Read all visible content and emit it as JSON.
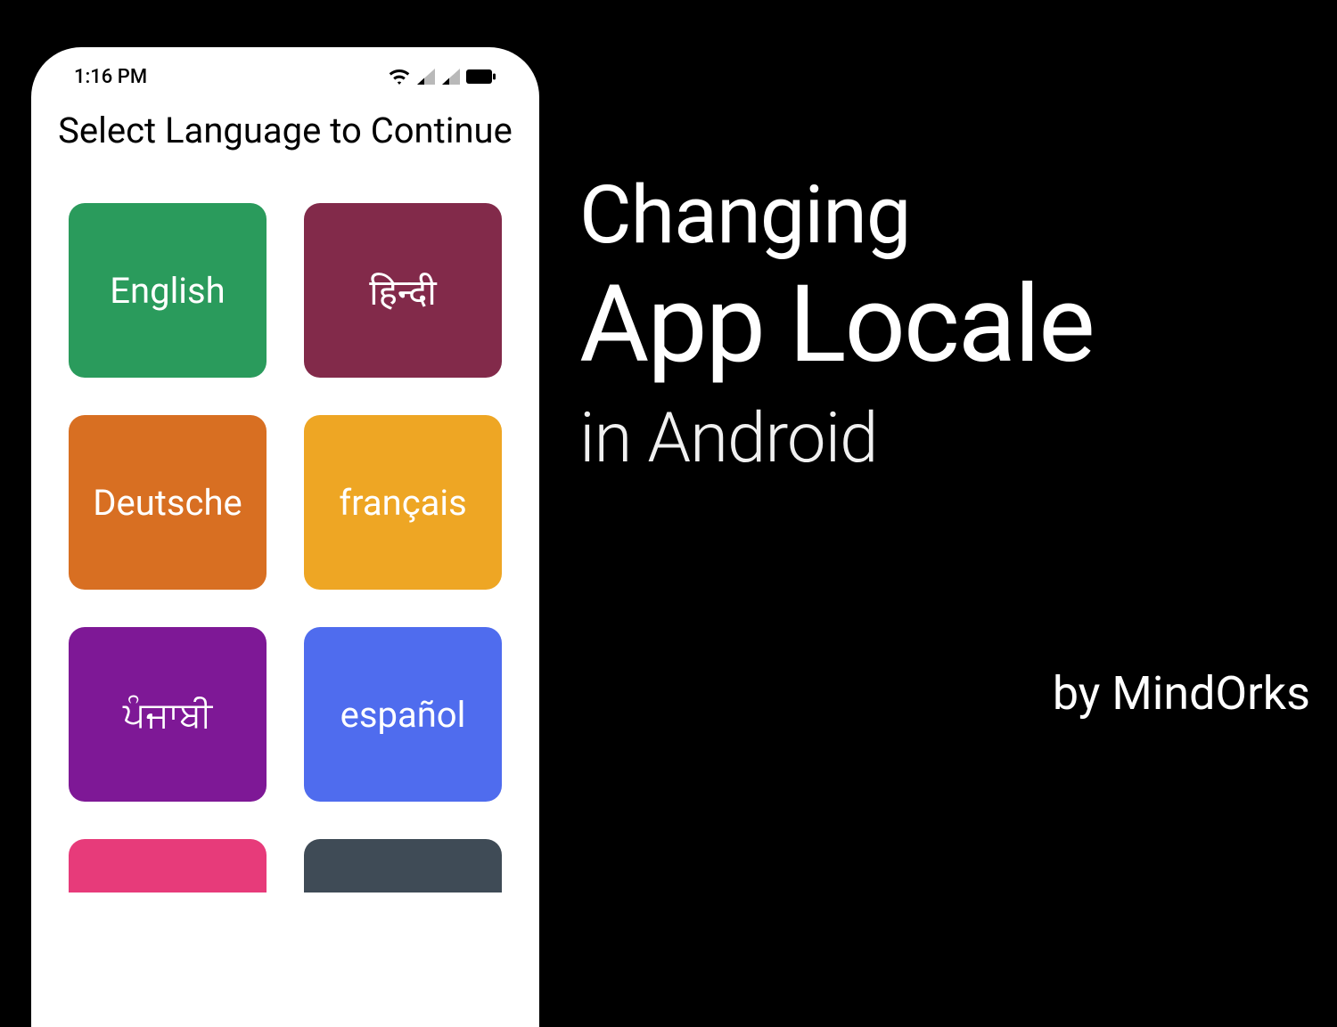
{
  "status": {
    "time": "1:16 PM"
  },
  "screen": {
    "title": "Select Language to Continue"
  },
  "languages": [
    {
      "label": "English",
      "color": "#2a9b5c"
    },
    {
      "label": "हिन्दी",
      "color": "#822a4a"
    },
    {
      "label": "Deutsche",
      "color": "#d86f22"
    },
    {
      "label": "français",
      "color": "#eea624"
    },
    {
      "label": "ਪੰਜਾਬੀ",
      "color": "#7e1896"
    },
    {
      "label": "español",
      "color": "#4f6cee"
    },
    {
      "label": "",
      "color": "#e73b7a"
    },
    {
      "label": "",
      "color": "#3f4b56"
    }
  ],
  "headline": {
    "line1": "Changing",
    "line2": "App Locale",
    "line3": "in Android"
  },
  "byline": "by MindOrks"
}
